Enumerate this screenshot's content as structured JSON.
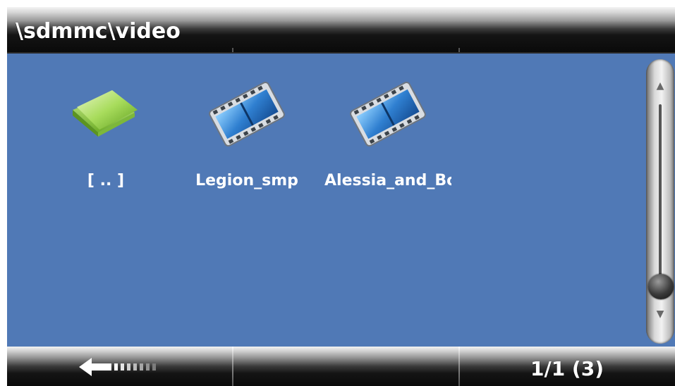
{
  "header": {
    "path": "\\sdmmc\\video"
  },
  "files": [
    {
      "label": "[ .. ]",
      "icon": "folder-icon",
      "type": "parent-folder"
    },
    {
      "label": "Legion_smp",
      "icon": "film-icon",
      "type": "video"
    },
    {
      "label": "Alessia_and_Bo",
      "icon": "film-icon",
      "type": "video"
    }
  ],
  "footer": {
    "back_icon": "back-arrow-icon",
    "page_info": "1/1 (3)"
  },
  "colors": {
    "content_background": "#5079b6",
    "label_text": "#ffffff",
    "folder_green": "#9ad24a",
    "film_blue": "#2f7fd0"
  }
}
